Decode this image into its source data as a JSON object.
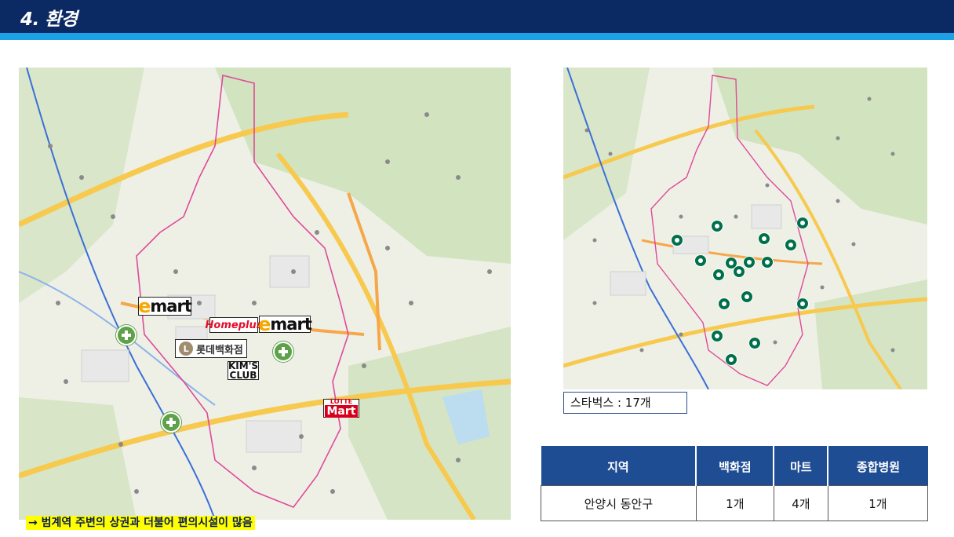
{
  "header": {
    "title": "4. 환경"
  },
  "left_map": {
    "brands": {
      "emart_left": "mart",
      "emart_right": "mart",
      "homeplus": "Homeplus",
      "lotte_dept": "롯데백화점",
      "kims_line1": "KIM'S",
      "kims_line2": "CLUB",
      "lotte_mart_top": "LOTTE",
      "lotte_mart_bottom": "Mart"
    },
    "note": "→ 범계역 주변의 상권과 더불어 편의시설이 많음"
  },
  "right_map": {
    "caption": "스타벅스 : 17개"
  },
  "table": {
    "headers": [
      "지역",
      "백화점",
      "마트",
      "종합병원"
    ],
    "rows": [
      [
        "안양시 동안구",
        "1개",
        "4개",
        "1개"
      ]
    ]
  },
  "colors": {
    "header_bg": "#0b2a63",
    "header_stripe": "#1da1e6",
    "table_header": "#1f4d94",
    "note_highlight": "#ffff00",
    "starbucks_green": "#00704a",
    "hospital_green": "#5fa14a"
  }
}
